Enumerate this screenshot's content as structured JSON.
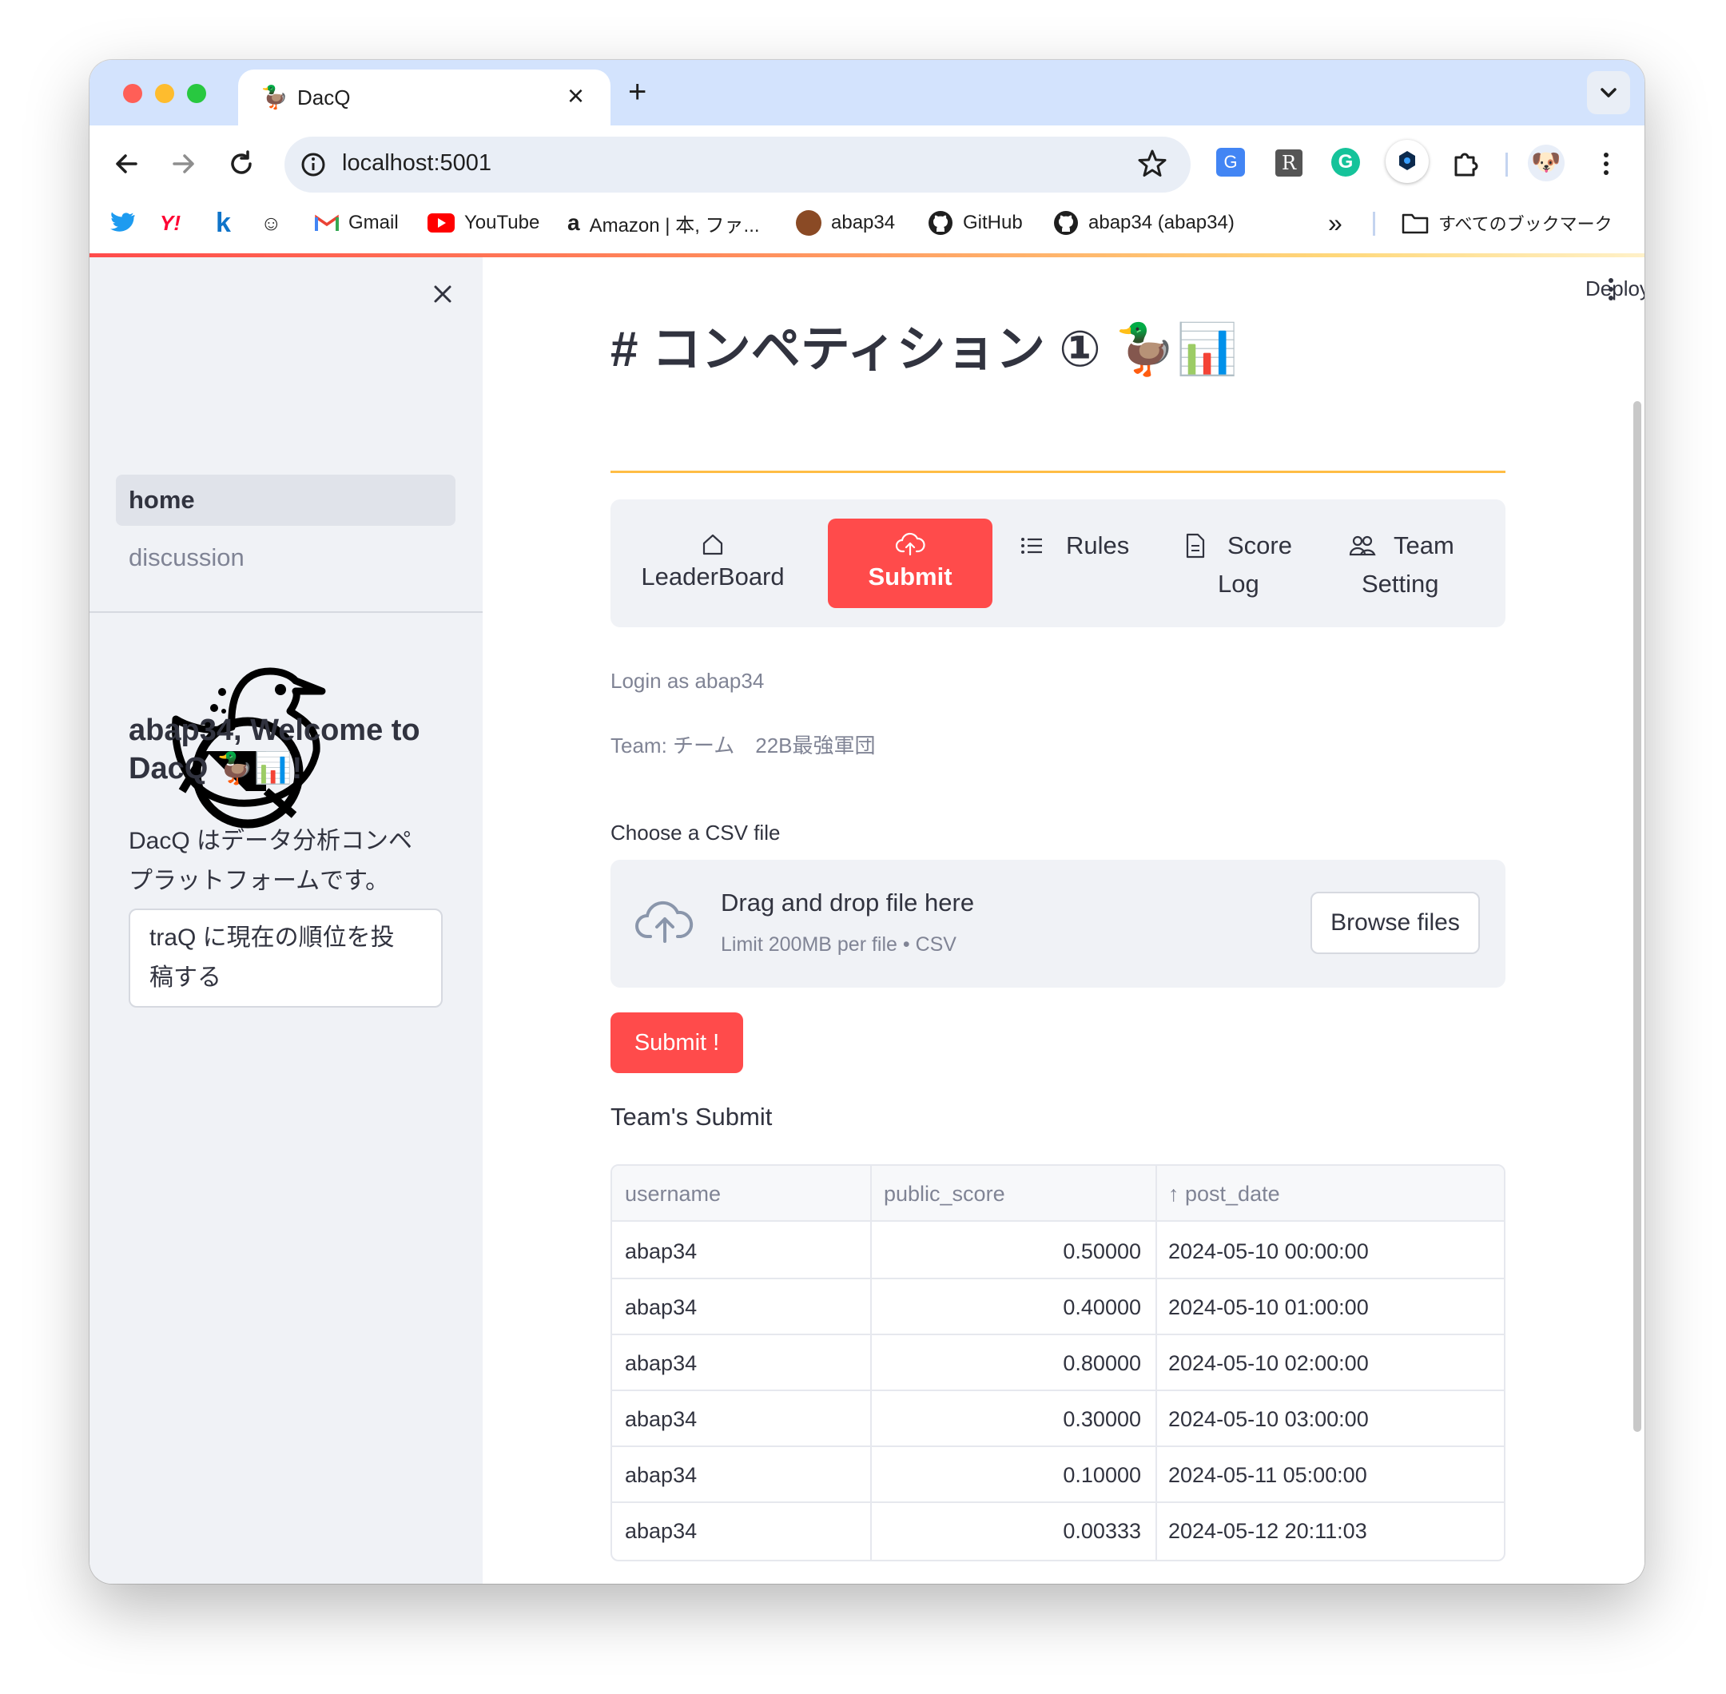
{
  "browser": {
    "tab_title": "DacQ",
    "tab_close": "×",
    "new_tab": "+",
    "url": "localhost:5001",
    "bookmarks": [
      {
        "label": "Gmail"
      },
      {
        "label": "YouTube"
      },
      {
        "label": "Amazon | 本, ファ..."
      },
      {
        "label": "abap34"
      },
      {
        "label": "GitHub"
      },
      {
        "label": "abap34 (abap34)"
      }
    ],
    "more_bookmarks": "»",
    "all_bookmarks": "すべてのブックマーク"
  },
  "app": {
    "deploy_label": "Deploy",
    "sidebar": {
      "close": "×",
      "nav": [
        {
          "label": "home",
          "active": true
        },
        {
          "label": "discussion",
          "active": false
        }
      ],
      "welcome_line1": "abap34, Welcome to",
      "welcome_line2": "DacQ 🦆📊!",
      "description_line1": "DacQ はデータ分析コンペ",
      "description_line2": "プラットフォームです。",
      "traq_button_line1": "traQ に現在の順位を投",
      "traq_button_line2": "稿する"
    },
    "title": "# コンペティション ① 🦆📊",
    "tabs": [
      {
        "line1": "",
        "line2": "LeaderBoard",
        "icon": "home-icon",
        "active": false
      },
      {
        "line1": "",
        "line2": "Submit",
        "icon": "cloud-upload-icon",
        "active": true
      },
      {
        "line1": "Rules",
        "line2": "",
        "icon": "list-icon",
        "active": false
      },
      {
        "line1": "Score",
        "line2": "Log",
        "icon": "document-icon",
        "active": false
      },
      {
        "line1": "Team",
        "line2": "Setting",
        "icon": "people-icon",
        "active": false
      }
    ],
    "login_text": "Login as abap34",
    "team_text": "Team: チーム　22B最強軍団",
    "uploader": {
      "label": "Choose a CSV file",
      "drag_text": "Drag and drop file here",
      "limit_text": "Limit 200MB per file • CSV",
      "browse_label": "Browse files"
    },
    "submit_button": "Submit !",
    "team_submit_heading": "Team's Submit",
    "table": {
      "columns": [
        "username",
        "public_score",
        "↑ post_date"
      ],
      "rows": [
        [
          "abap34",
          "0.50000",
          "2024-05-10 00:00:00"
        ],
        [
          "abap34",
          "0.40000",
          "2024-05-10 01:00:00"
        ],
        [
          "abap34",
          "0.80000",
          "2024-05-10 02:00:00"
        ],
        [
          "abap34",
          "0.30000",
          "2024-05-10 03:00:00"
        ],
        [
          "abap34",
          "0.10000",
          "2024-05-11 05:00:00"
        ],
        [
          "abap34",
          "0.00333",
          "2024-05-12 20:11:03"
        ]
      ]
    },
    "colors": {
      "primary": "#ff4b4b",
      "sidebar_bg": "#f0f2f6",
      "text": "#31333f",
      "muted": "#808495"
    }
  }
}
